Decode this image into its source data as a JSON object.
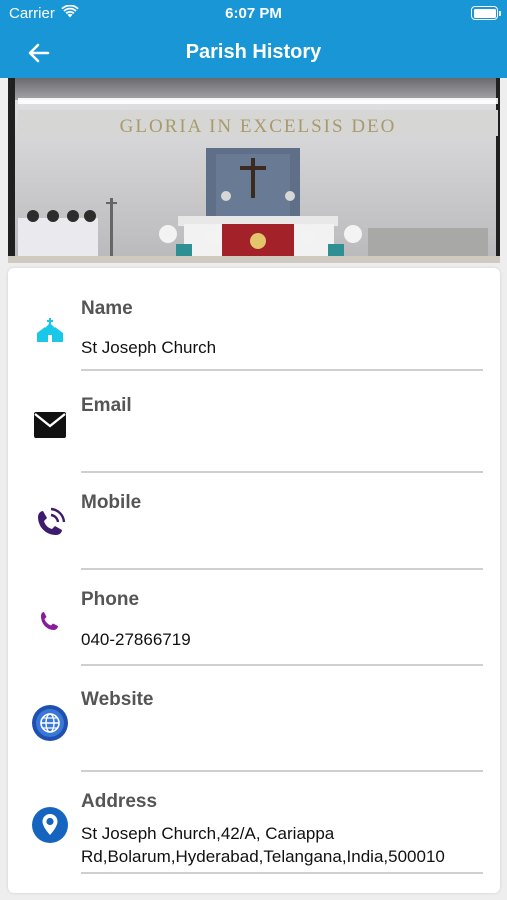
{
  "status_bar": {
    "carrier": "Carrier",
    "time": "6:07 PM"
  },
  "header": {
    "title": "Parish History",
    "back_icon": "back-arrow-icon"
  },
  "hero": {
    "inscription": "GLORIA IN EXCELSIS DEO"
  },
  "fields": {
    "name": {
      "label": "Name",
      "value": "St Joseph Church",
      "icon": "church-icon",
      "icon_color": "#19c8e8"
    },
    "email": {
      "label": "Email",
      "value": "",
      "icon": "envelope-icon",
      "icon_color": "#111111"
    },
    "mobile": {
      "label": "Mobile",
      "value": "",
      "icon": "phone-ringing-icon",
      "icon_color": "#3d1c6e"
    },
    "phone": {
      "label": "Phone",
      "value": "040-27866719",
      "icon": "phone-icon",
      "icon_color": "#8a1a9e"
    },
    "website": {
      "label": "Website",
      "value": "",
      "icon": "globe-icon",
      "icon_color": "#1f4fb0"
    },
    "address": {
      "label": "Address",
      "line1": "St Joseph Church,42/A, Cariappa",
      "line2": "Rd,Bolarum,Hyderabad,Telangana,India,500010",
      "icon": "location-pin-icon",
      "icon_color": "#1565c0"
    }
  },
  "colors": {
    "primary": "#1996d5",
    "label": "#555555",
    "divider": "#cfcfcf"
  }
}
